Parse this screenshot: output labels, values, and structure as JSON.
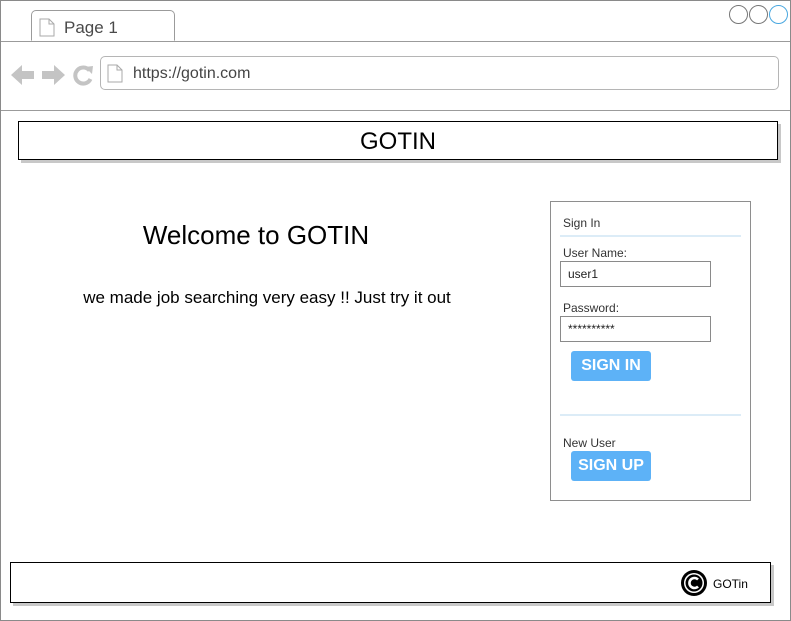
{
  "browser": {
    "tab_label": "Page 1",
    "url": "https://gotin.com",
    "icons": {
      "back": "arrow-left-icon",
      "forward": "arrow-right-icon",
      "reload": "reload-icon",
      "page": "page-icon"
    }
  },
  "header": {
    "title": "GOTIN"
  },
  "welcome": {
    "title": "Welcome to GOTIN",
    "subtitle": "we made job searching very easy !! Just try it out"
  },
  "signin": {
    "heading": "Sign In",
    "username_label": "User Name:",
    "username_value": "user1",
    "password_label": "Password:",
    "password_value": "**********",
    "signin_button": "SIGN IN",
    "newuser_label": "New User",
    "signup_button": "SIGN UP",
    "accent_color": "#5db2f7"
  },
  "footer": {
    "text": "GOTin",
    "icon": "copyright-icon"
  }
}
